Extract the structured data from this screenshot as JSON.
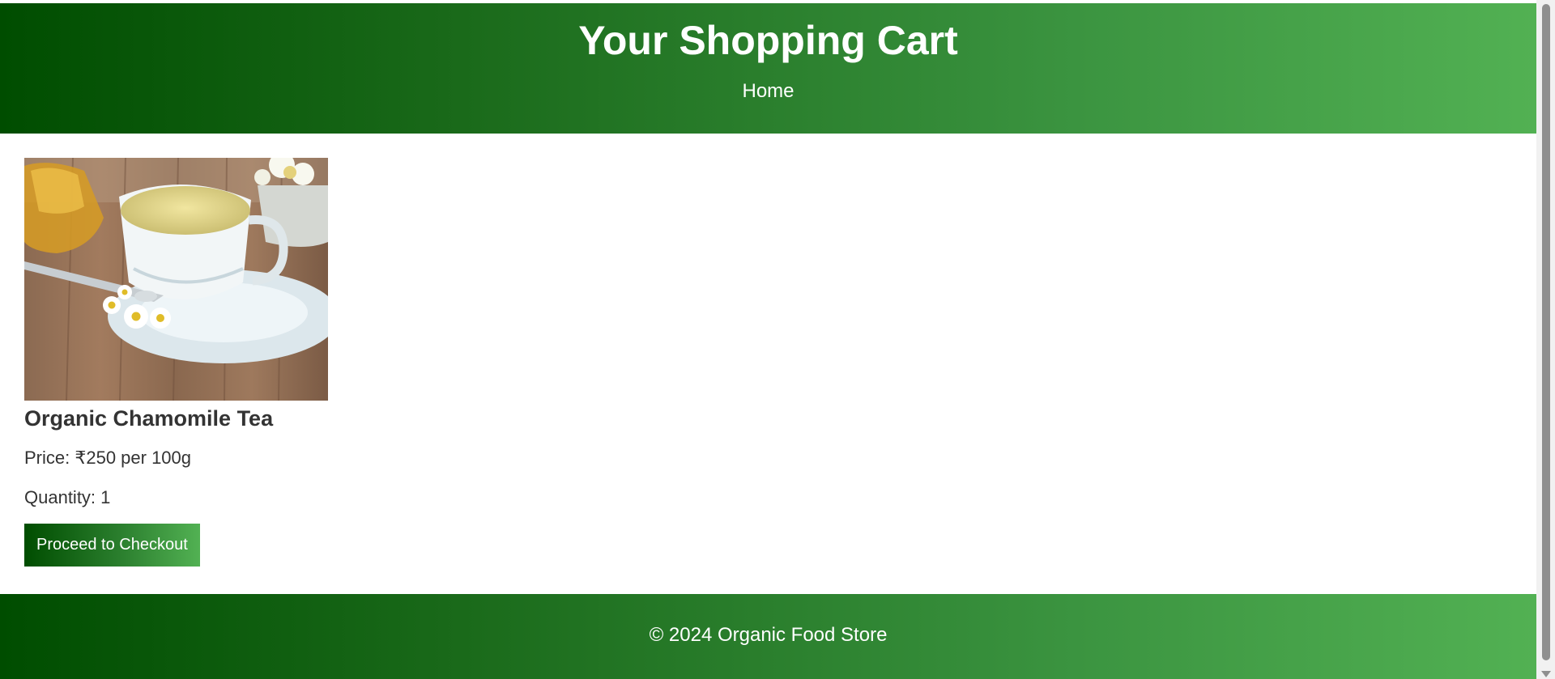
{
  "header": {
    "title": "Your Shopping Cart",
    "nav": [
      {
        "label": "Home"
      }
    ]
  },
  "cart": {
    "items": [
      {
        "image_alt": "Organic Chamomile Tea",
        "name": "Organic Chamomile Tea",
        "price_text": "Price: ₹250 per 100g",
        "quantity_text": "Quantity: 1"
      }
    ],
    "checkout_label": "Proceed to Checkout"
  },
  "footer": {
    "text": "© 2024 Organic Food Store"
  },
  "colors": {
    "header_dark": "#004d00",
    "header_light": "#52b153",
    "text": "#333333"
  }
}
